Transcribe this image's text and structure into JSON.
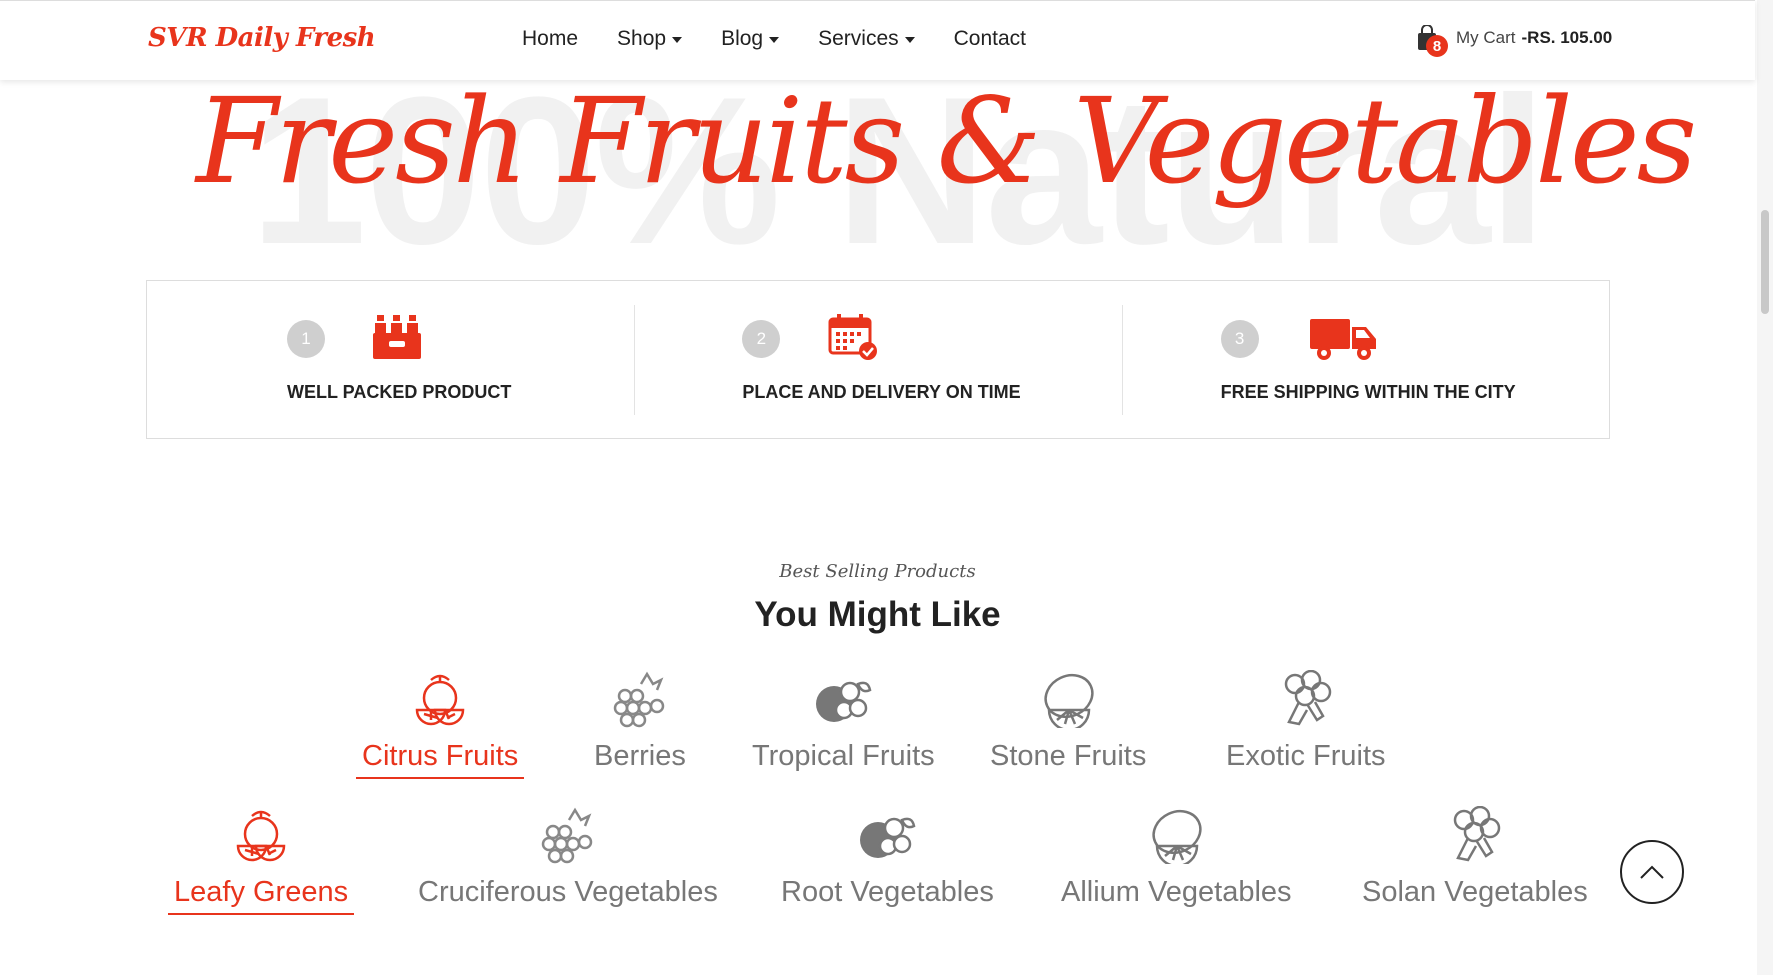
{
  "header": {
    "logo": "SVR Daily Fresh",
    "nav": [
      {
        "label": "Home",
        "has_dropdown": false
      },
      {
        "label": "Shop",
        "has_dropdown": true
      },
      {
        "label": "Blog",
        "has_dropdown": true
      },
      {
        "label": "Services",
        "has_dropdown": true
      },
      {
        "label": "Contact",
        "has_dropdown": false
      }
    ],
    "cart": {
      "count": "8",
      "label": "My Cart",
      "total": "-RS. 105.00",
      "icon": "shopping-bag-icon"
    }
  },
  "hero": {
    "background_text": "100% Natural",
    "title": "Fresh Fruits & Vegetables"
  },
  "features": [
    {
      "number": "1",
      "title": "WELL PACKED PRODUCT",
      "icon": "bottle-crate-icon"
    },
    {
      "number": "2",
      "title": "PLACE AND DELIVERY ON TIME",
      "icon": "calendar-check-icon"
    },
    {
      "number": "3",
      "title": "FREE SHIPPING WITHIN THE CITY",
      "icon": "delivery-truck-icon"
    }
  ],
  "section": {
    "subtitle": "Best Selling Products",
    "title": "You Might Like"
  },
  "categories_row1": [
    {
      "label": "Citrus Fruits",
      "icon": "citrus-icon",
      "active": true
    },
    {
      "label": "Berries",
      "icon": "berries-icon",
      "active": false
    },
    {
      "label": "Tropical Fruits",
      "icon": "tropical-fruits-icon",
      "active": false
    },
    {
      "label": "Stone Fruits",
      "icon": "lemon-slice-icon",
      "active": false
    },
    {
      "label": "Exotic Fruits",
      "icon": "broccoli-icon",
      "active": false
    }
  ],
  "categories_row2": [
    {
      "label": "Leafy Greens",
      "icon": "citrus-icon",
      "active": true
    },
    {
      "label": "Cruciferous Vegetables",
      "icon": "berries-icon",
      "active": false
    },
    {
      "label": "Root Vegetables",
      "icon": "tropical-fruits-icon",
      "active": false
    },
    {
      "label": "Allium Vegetables",
      "icon": "lemon-slice-icon",
      "active": false
    },
    {
      "label": "Solan Vegetables",
      "icon": "broccoli-icon",
      "active": false
    }
  ],
  "colors": {
    "accent": "#e8341c",
    "muted": "#777777",
    "badge_grey": "#cfcfcf"
  }
}
